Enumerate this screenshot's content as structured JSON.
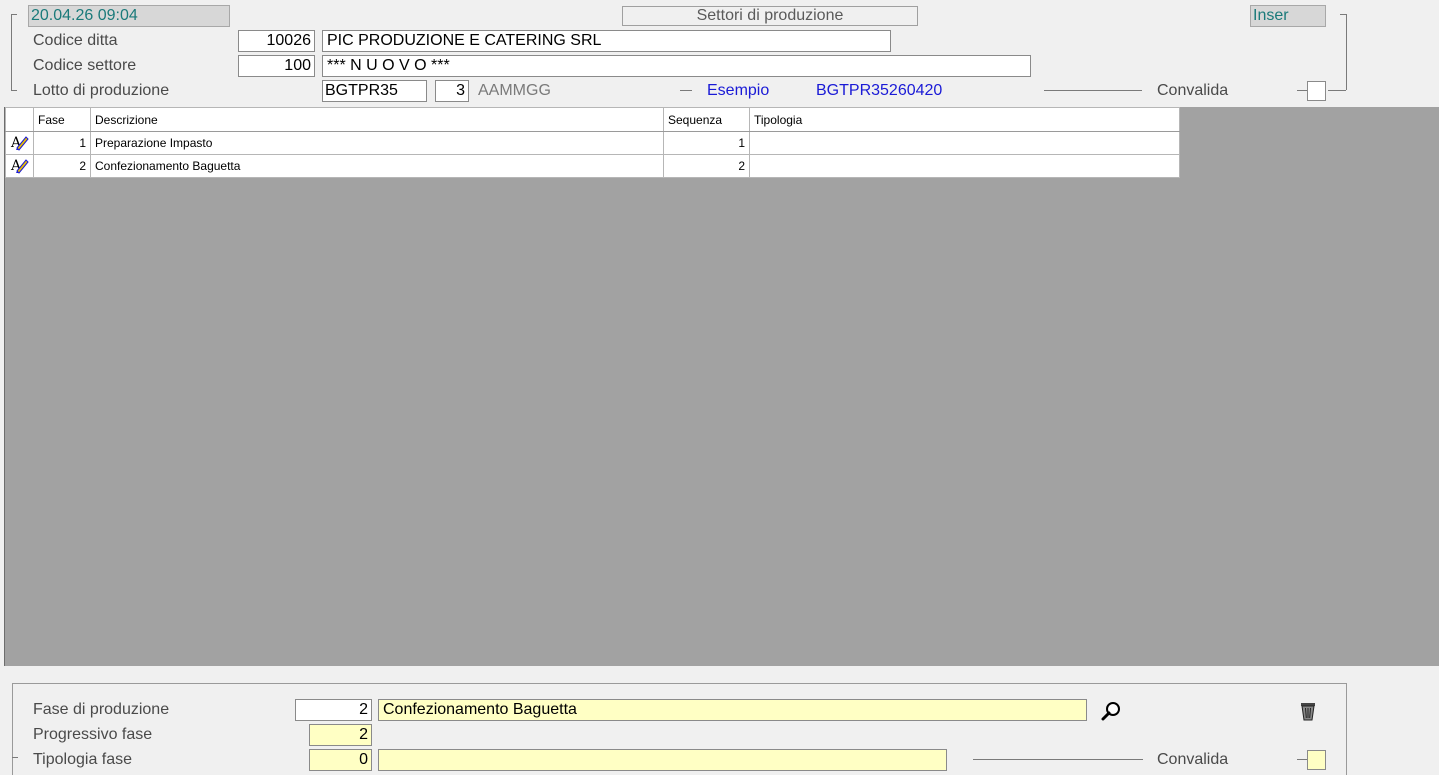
{
  "header": {
    "datetime": "20.04.26 09:04",
    "title": "Settori di produzione",
    "mode": "Inser"
  },
  "form": {
    "codice_ditta_label": "Codice ditta",
    "codice_ditta_value": "10026",
    "ditta_name": "PIC PRODUZIONE E CATERING SRL",
    "codice_settore_label": "Codice settore",
    "codice_settore_value": "100",
    "settore_name": "*** N U O V O ***",
    "lotto_label": "Lotto  di produzione",
    "lotto_prefix": "BGTPR35",
    "lotto_digits": "3",
    "lotto_format": "AAMMGG",
    "esempio_label": "Esempio",
    "esempio_value": "BGTPR35260420",
    "convalida_label": "Convalida"
  },
  "grid": {
    "columns": [
      "Fase",
      "Descrizione",
      "Sequenza",
      "Tipologia"
    ],
    "rows": [
      {
        "fase": "1",
        "descrizione": "Preparazione Impasto",
        "sequenza": "1",
        "tipologia": ""
      },
      {
        "fase": "2",
        "descrizione": "Confezionamento Baguetta",
        "sequenza": "2",
        "tipologia": ""
      }
    ]
  },
  "detail": {
    "fase_label": "Fase di produzione",
    "fase_value": "2",
    "fase_descr": "Confezionamento Baguetta",
    "progressivo_label": "Progressivo fase",
    "progressivo_value": "2",
    "tipologia_label": "Tipologia   fase",
    "tipologia_value": "0",
    "tipologia_descr": "",
    "convalida_label": "Convalida"
  },
  "colors": {
    "accent_teal": "#1a7a7a",
    "link_blue": "#1a1ad6",
    "required_yellow": "#ffffc4",
    "grid_background": "#a2a2a2"
  },
  "icons": {
    "row_edit": "edit-pencil-icon",
    "search": "search-icon",
    "delete": "trash-icon"
  }
}
